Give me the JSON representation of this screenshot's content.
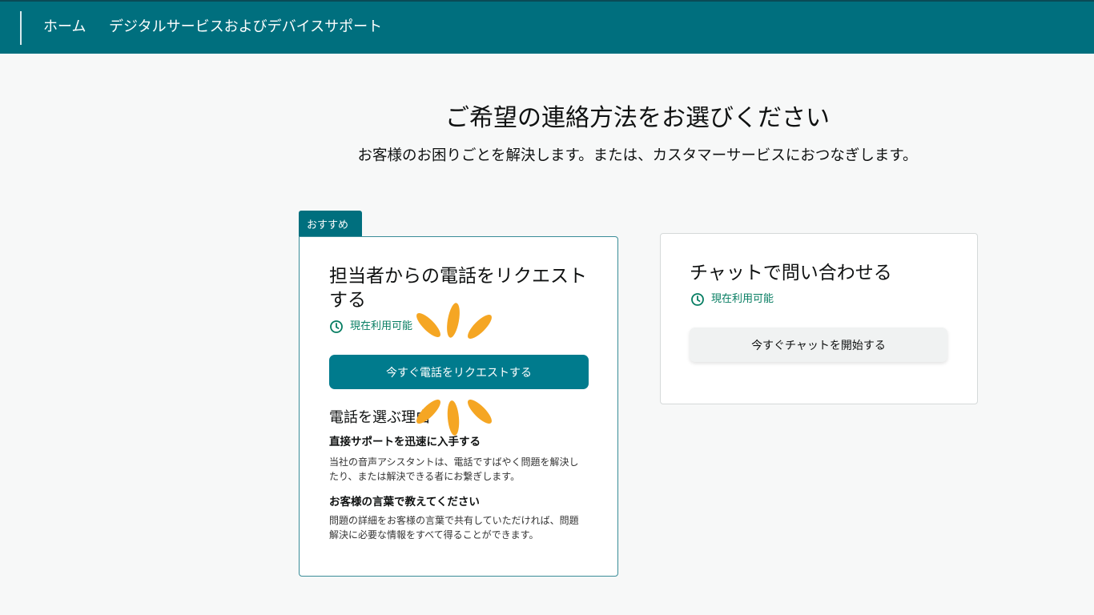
{
  "nav": {
    "home": "ホーム",
    "digital_support": "デジタルサービスおよびデバイスサポート"
  },
  "page": {
    "heading": "ご希望の連絡方法をお選びください",
    "subheading": "お客様のお困りごとを解決します。または、カスタマーサービスにおつなぎします。"
  },
  "phone_card": {
    "badge": "おすすめ",
    "title": "担当者からの電話をリクエストする",
    "availability": "現在利用可能",
    "button_label": "今すぐ電話をリクエストする",
    "why_title": "電話を選ぶ理由",
    "reasons": [
      {
        "title": "直接サポートを迅速に入手する",
        "text": "当社の音声アシスタントは、電話ですばやく問題を解決したり、または解決できる者にお繋ぎします。"
      },
      {
        "title": "お客様の言葉で教えてください",
        "text": "問題の詳細をお客様の言葉で共有していただければ、問題解決に必要な情報をすべて得ることができます。"
      }
    ]
  },
  "chat_card": {
    "title": "チャットで問い合わせる",
    "availability": "現在利用可能",
    "button_label": "今すぐチャットを開始する"
  },
  "colors": {
    "header": "#006f7e",
    "primary_button": "#007b8d",
    "available_green": "#067d62",
    "loading_spinner": "#f5a623"
  },
  "icons": [
    "clock-icon",
    "loading-spinner-icon"
  ]
}
